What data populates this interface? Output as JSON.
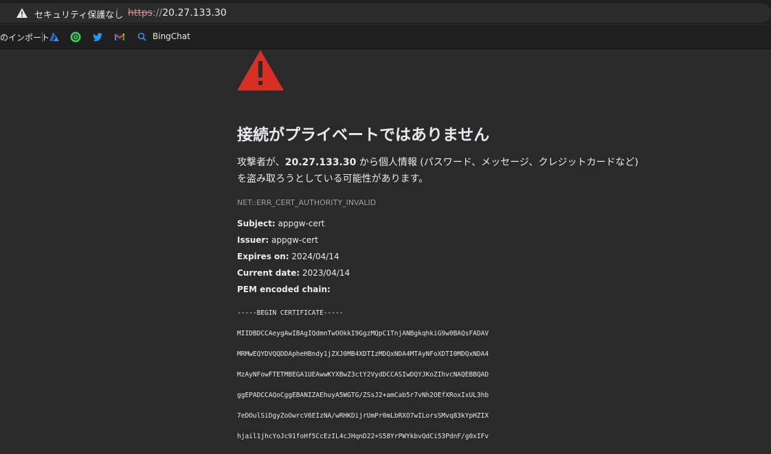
{
  "addressbar": {
    "security_label": "セキュリティ保護なし",
    "url_scheme": "https",
    "url_sep": "://",
    "url_host": "20.27.133.30"
  },
  "bookmarks": {
    "import_label": "のインポート",
    "items": [
      {
        "icon": "azure-icon",
        "color": "#3b8eea"
      },
      {
        "icon": "chatgpt-icon",
        "color": "#3ecf5a"
      },
      {
        "icon": "twitter-icon",
        "color": "#1d9bf0"
      },
      {
        "icon": "gmail-icon",
        "color": "#ea4335"
      },
      {
        "icon": "search-icon",
        "label": "BingChat",
        "color": "#3b8eea"
      }
    ]
  },
  "interstitial": {
    "headline": "接続がプライベートではありません",
    "explain_prefix": "攻撃者が、",
    "explain_host": "20.27.133.30",
    "explain_suffix": " から個人情報 (パスワード、メッセージ、クレジットカードなど) を盗み取ろうとしている可能性があります。",
    "error_code": "NET::ERR_CERT_AUTHORITY_INVALID",
    "subject_label": "Subject:",
    "subject_value": " appgw-cert",
    "issuer_label": "Issuer:",
    "issuer_value": " appgw-cert",
    "expires_label": "Expires on:",
    "expires_value": " 2024/04/14",
    "current_label": "Current date:",
    "current_value": " 2023/04/14",
    "pem_label": "PEM encoded chain:",
    "pem_lines": [
      "-----BEGIN CERTIFICATE-----",
      "MIIDBDCCAeygAwIBAgIQdmnTwOOkkI9GgzMQpC1TnjANBgkqhkiG9w0BAQsFADAV",
      "MRMwEQYDVQQDDApheHBndy1jZXJ0MB4XDTIzMDQxNDA4MTAyNFoXDTI0MDQxNDA4",
      "MzAyNFowFTETMBEGA1UEAwwKYXBwZ3ctY2VydDCCASIwDQYJKoZIhvcNAQEBBQAD",
      "ggEPADCCAQoCggEBANIZAEhuyA5WGTG/ZSsJ2+amCab5r7vNh2OEfXRoxIxUL3hb",
      "7eDOulSiDgyZoOwrcV6EIzNA/wRHKDijrUmPr0mLbRXO7wILorsSMvq83kYpHZIX",
      "hjail1jhcYoJc91foHf5CcEzIL4cJHqnD22+S58YrPWYkbvQdCi53PdnF/g0xIFv"
    ],
    "warning_color": "#d93025"
  }
}
